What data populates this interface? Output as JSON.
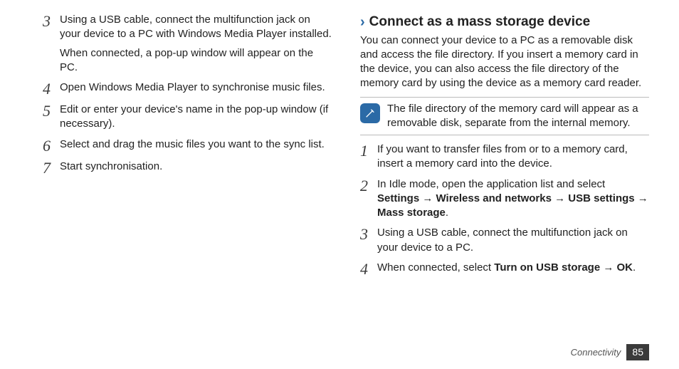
{
  "left": {
    "steps": [
      {
        "num": "3",
        "text": "Using a USB cable, connect the multifunction jack on your device to a PC with Windows Media Player installed.",
        "sub": "When connected, a pop-up window will appear on the PC."
      },
      {
        "num": "4",
        "text": "Open Windows Media Player to synchronise music files."
      },
      {
        "num": "5",
        "text": "Edit or enter your device's name in the pop-up window (if necessary)."
      },
      {
        "num": "6",
        "text": "Select and drag the music files you want to the sync list."
      },
      {
        "num": "7",
        "text": "Start synchronisation."
      }
    ]
  },
  "right": {
    "title": "Connect as a mass storage device",
    "intro": "You can connect your device to a PC as a removable disk and access the file directory. If you insert a memory card in the device, you can also access the file directory of the memory card by using the device as a memory card reader.",
    "note": "The file directory of the memory card will appear as a removable disk, separate from the internal memory.",
    "steps": [
      {
        "num": "1",
        "text": "If you want to transfer files from or to a memory card, insert a memory card into the device."
      },
      {
        "num": "2",
        "pre": "In Idle mode, open the application list and select ",
        "bold": "Settings → Wireless and networks → USB settings → Mass storage",
        "post": "."
      },
      {
        "num": "3",
        "text": "Using a USB cable, connect the multifunction jack on your device to a PC."
      },
      {
        "num": "4",
        "pre": "When connected, select ",
        "bold": "Turn on USB storage → OK",
        "post": "."
      }
    ]
  },
  "footer": {
    "section": "Connectivity",
    "page": "85"
  }
}
